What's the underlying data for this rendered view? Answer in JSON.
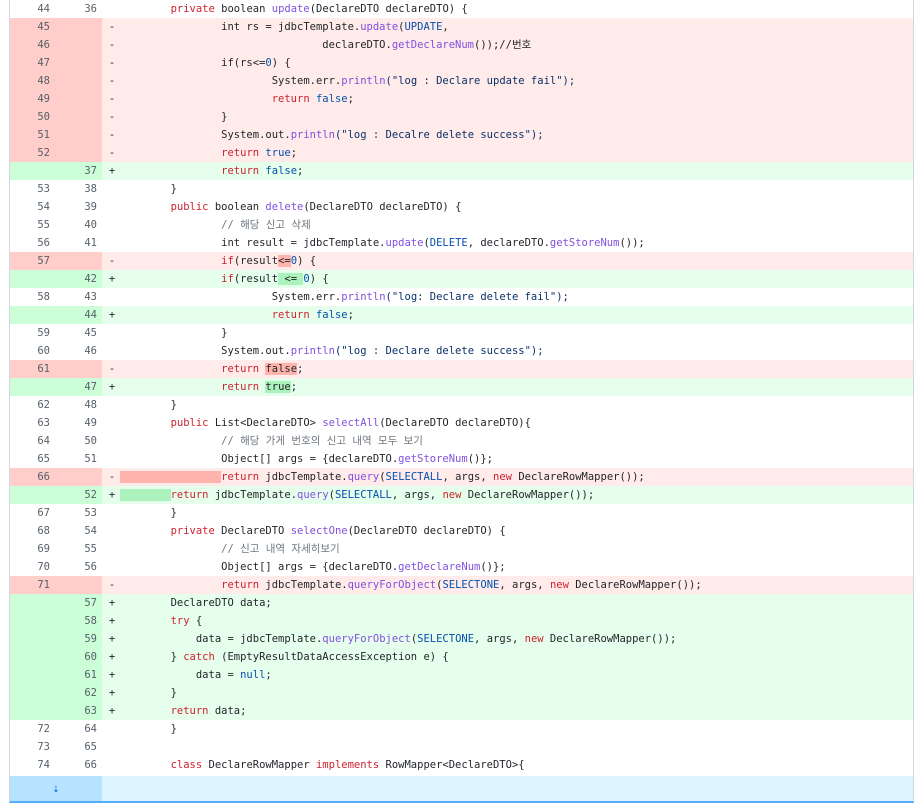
{
  "colors": {
    "deleted_bg": "#ffebe9",
    "deleted_gutter": "#ffcecb",
    "added_bg": "#e6ffec",
    "added_gutter": "#ccffd8",
    "expander_bg": "#ddf4ff",
    "border_accent": "#54aeff"
  },
  "lines": [
    {
      "type": "ctx",
      "old": "44",
      "new": "36",
      "mark": "",
      "indent": "",
      "code": [
        {
          "t": "        "
        },
        {
          "t": "private",
          "c": "kw"
        },
        {
          "t": " boolean "
        },
        {
          "t": "update",
          "c": "fn"
        },
        {
          "t": "(DeclareDTO declareDTO) {"
        }
      ]
    },
    {
      "type": "del",
      "old": "45",
      "new": "",
      "mark": "-",
      "code": [
        {
          "t": "                int rs = jdbcTemplate."
        },
        {
          "t": "update",
          "c": "fn"
        },
        {
          "t": "("
        },
        {
          "t": "UPDATE",
          "c": "cn"
        },
        {
          "t": ","
        }
      ]
    },
    {
      "type": "del",
      "old": "46",
      "new": "",
      "mark": "-",
      "code": [
        {
          "t": "                                declareDTO."
        },
        {
          "t": "getDeclareNum",
          "c": "fn"
        },
        {
          "t": "());//번호"
        }
      ]
    },
    {
      "type": "del",
      "old": "47",
      "new": "",
      "mark": "-",
      "code": [
        {
          "t": "                if(rs<="
        },
        {
          "t": "0",
          "c": "cn"
        },
        {
          "t": ") {"
        }
      ]
    },
    {
      "type": "del",
      "old": "48",
      "new": "",
      "mark": "-",
      "code": [
        {
          "t": "                        System.err."
        },
        {
          "t": "println",
          "c": "fn"
        },
        {
          "t": "(\"log : Declare update fail\");",
          "c": "str"
        }
      ]
    },
    {
      "type": "del",
      "old": "49",
      "new": "",
      "mark": "-",
      "code": [
        {
          "t": "                        "
        },
        {
          "t": "return",
          "c": "kw"
        },
        {
          "t": " "
        },
        {
          "t": "false",
          "c": "cn"
        },
        {
          "t": ";"
        }
      ]
    },
    {
      "type": "del",
      "old": "50",
      "new": "",
      "mark": "-",
      "code": [
        {
          "t": "                }"
        }
      ]
    },
    {
      "type": "del",
      "old": "51",
      "new": "",
      "mark": "-",
      "code": [
        {
          "t": "                System.out."
        },
        {
          "t": "println",
          "c": "fn"
        },
        {
          "t": "(\"log : Decalre delete success\");",
          "c": "str"
        }
      ]
    },
    {
      "type": "del",
      "old": "52",
      "new": "",
      "mark": "-",
      "code": [
        {
          "t": "                "
        },
        {
          "t": "return",
          "c": "kw"
        },
        {
          "t": " "
        },
        {
          "t": "true",
          "c": "cn"
        },
        {
          "t": ";"
        }
      ]
    },
    {
      "type": "add",
      "old": "",
      "new": "37",
      "mark": "+",
      "code": [
        {
          "t": "                "
        },
        {
          "t": "return",
          "c": "kw"
        },
        {
          "t": " "
        },
        {
          "t": "false",
          "c": "cn"
        },
        {
          "t": ";"
        }
      ]
    },
    {
      "type": "ctx",
      "old": "53",
      "new": "38",
      "mark": "",
      "code": [
        {
          "t": "        }"
        }
      ]
    },
    {
      "type": "ctx",
      "old": "54",
      "new": "39",
      "mark": "",
      "code": [
        {
          "t": "        "
        },
        {
          "t": "public",
          "c": "kw"
        },
        {
          "t": " boolean "
        },
        {
          "t": "delete",
          "c": "fn"
        },
        {
          "t": "(DeclareDTO declareDTO) {"
        }
      ]
    },
    {
      "type": "ctx",
      "old": "55",
      "new": "40",
      "mark": "",
      "code": [
        {
          "t": "                "
        },
        {
          "t": "// 해당 신고 삭제",
          "c": "cmt"
        }
      ]
    },
    {
      "type": "ctx",
      "old": "56",
      "new": "41",
      "mark": "",
      "code": [
        {
          "t": "                int result = jdbcTemplate."
        },
        {
          "t": "update",
          "c": "fn"
        },
        {
          "t": "("
        },
        {
          "t": "DELETE",
          "c": "cn"
        },
        {
          "t": ", declareDTO."
        },
        {
          "t": "getStoreNum",
          "c": "fn"
        },
        {
          "t": "());"
        }
      ]
    },
    {
      "type": "del",
      "old": "57",
      "new": "",
      "mark": "-",
      "code": [
        {
          "t": "                "
        },
        {
          "t": "if",
          "c": "kw"
        },
        {
          "t": "(result"
        },
        {
          "t": "<=",
          "c": "hl-del"
        },
        {
          "t": "0",
          "c": "cn"
        },
        {
          "t": ") {"
        }
      ]
    },
    {
      "type": "add",
      "old": "",
      "new": "42",
      "mark": "+",
      "code": [
        {
          "t": "                "
        },
        {
          "t": "if",
          "c": "kw"
        },
        {
          "t": "(result"
        },
        {
          "t": " <= ",
          "c": "hl-add"
        },
        {
          "t": "0",
          "c": "cn"
        },
        {
          "t": ") {"
        }
      ]
    },
    {
      "type": "ctx",
      "old": "58",
      "new": "43",
      "mark": "",
      "code": [
        {
          "t": "                        System.err."
        },
        {
          "t": "println",
          "c": "fn"
        },
        {
          "t": "(\"log: Declare delete fail\");",
          "c": "str"
        }
      ]
    },
    {
      "type": "add",
      "old": "",
      "new": "44",
      "mark": "+",
      "code": [
        {
          "t": "                        "
        },
        {
          "t": "return",
          "c": "kw"
        },
        {
          "t": " "
        },
        {
          "t": "false",
          "c": "cn"
        },
        {
          "t": ";"
        }
      ]
    },
    {
      "type": "ctx",
      "old": "59",
      "new": "45",
      "mark": "",
      "code": [
        {
          "t": "                }"
        }
      ]
    },
    {
      "type": "ctx",
      "old": "60",
      "new": "46",
      "mark": "",
      "code": [
        {
          "t": "                System.out."
        },
        {
          "t": "println",
          "c": "fn"
        },
        {
          "t": "(\"log : Declare delete success\");",
          "c": "str"
        }
      ]
    },
    {
      "type": "del",
      "old": "61",
      "new": "",
      "mark": "-",
      "code": [
        {
          "t": "                "
        },
        {
          "t": "return",
          "c": "kw"
        },
        {
          "t": " "
        },
        {
          "t": "false",
          "c": "hl-del"
        },
        {
          "t": ";"
        }
      ]
    },
    {
      "type": "add",
      "old": "",
      "new": "47",
      "mark": "+",
      "code": [
        {
          "t": "                "
        },
        {
          "t": "return",
          "c": "kw"
        },
        {
          "t": " "
        },
        {
          "t": "true",
          "c": "hl-add"
        },
        {
          "t": ";"
        }
      ]
    },
    {
      "type": "ctx",
      "old": "62",
      "new": "48",
      "mark": "",
      "code": [
        {
          "t": "        }"
        }
      ]
    },
    {
      "type": "ctx",
      "old": "63",
      "new": "49",
      "mark": "",
      "code": [
        {
          "t": "        "
        },
        {
          "t": "public",
          "c": "kw"
        },
        {
          "t": " List<DeclareDTO> "
        },
        {
          "t": "selectAll",
          "c": "fn"
        },
        {
          "t": "(DeclareDTO declareDTO){"
        }
      ]
    },
    {
      "type": "ctx",
      "old": "64",
      "new": "50",
      "mark": "",
      "code": [
        {
          "t": "                "
        },
        {
          "t": "// 해당 가게 번호의 신고 내역 모두 보기",
          "c": "cmt"
        }
      ]
    },
    {
      "type": "ctx",
      "old": "65",
      "new": "51",
      "mark": "",
      "code": [
        {
          "t": "                Object[] args = {declareDTO."
        },
        {
          "t": "getStoreNum",
          "c": "fn"
        },
        {
          "t": "()};"
        }
      ]
    },
    {
      "type": "del",
      "old": "66",
      "new": "",
      "mark": "-",
      "code": [
        {
          "t": "                ",
          "c": "hl-del"
        },
        {
          "t": "return",
          "c": "kw"
        },
        {
          "t": " jdbcTemplate."
        },
        {
          "t": "query",
          "c": "fn"
        },
        {
          "t": "("
        },
        {
          "t": "SELECTALL",
          "c": "cn"
        },
        {
          "t": ", args, "
        },
        {
          "t": "new",
          "c": "kw"
        },
        {
          "t": " DeclareRowMapper());"
        }
      ]
    },
    {
      "type": "add",
      "old": "",
      "new": "52",
      "mark": "+",
      "code": [
        {
          "t": "        ",
          "c": "hl-add"
        },
        {
          "t": "return",
          "c": "kw"
        },
        {
          "t": " jdbcTemplate."
        },
        {
          "t": "query",
          "c": "fn"
        },
        {
          "t": "("
        },
        {
          "t": "SELECTALL",
          "c": "cn"
        },
        {
          "t": ", args, "
        },
        {
          "t": "new",
          "c": "kw"
        },
        {
          "t": " DeclareRowMapper());"
        }
      ]
    },
    {
      "type": "ctx",
      "old": "67",
      "new": "53",
      "mark": "",
      "code": [
        {
          "t": "        }"
        }
      ]
    },
    {
      "type": "ctx",
      "old": "68",
      "new": "54",
      "mark": "",
      "code": [
        {
          "t": "        "
        },
        {
          "t": "private",
          "c": "kw"
        },
        {
          "t": " DeclareDTO "
        },
        {
          "t": "selectOne",
          "c": "fn"
        },
        {
          "t": "(DeclareDTO declareDTO) {"
        }
      ]
    },
    {
      "type": "ctx",
      "old": "69",
      "new": "55",
      "mark": "",
      "code": [
        {
          "t": "                "
        },
        {
          "t": "// 신고 내역 자세히보기",
          "c": "cmt"
        }
      ]
    },
    {
      "type": "ctx",
      "old": "70",
      "new": "56",
      "mark": "",
      "code": [
        {
          "t": "                Object[] args = {declareDTO."
        },
        {
          "t": "getDeclareNum",
          "c": "fn"
        },
        {
          "t": "()};"
        }
      ]
    },
    {
      "type": "del",
      "old": "71",
      "new": "",
      "mark": "-",
      "code": [
        {
          "t": "                "
        },
        {
          "t": "return",
          "c": "kw"
        },
        {
          "t": " jdbcTemplate."
        },
        {
          "t": "queryForObject",
          "c": "fn"
        },
        {
          "t": "("
        },
        {
          "t": "SELECTONE",
          "c": "cn"
        },
        {
          "t": ", args, "
        },
        {
          "t": "new",
          "c": "kw"
        },
        {
          "t": " DeclareRowMapper());"
        }
      ]
    },
    {
      "type": "add",
      "old": "",
      "new": "57",
      "mark": "+",
      "code": [
        {
          "t": "        DeclareDTO data;"
        }
      ]
    },
    {
      "type": "add",
      "old": "",
      "new": "58",
      "mark": "+",
      "code": [
        {
          "t": "        "
        },
        {
          "t": "try",
          "c": "kw"
        },
        {
          "t": " {"
        }
      ]
    },
    {
      "type": "add",
      "old": "",
      "new": "59",
      "mark": "+",
      "code": [
        {
          "t": "            data = jdbcTemplate."
        },
        {
          "t": "queryForObject",
          "c": "fn"
        },
        {
          "t": "("
        },
        {
          "t": "SELECTONE",
          "c": "cn"
        },
        {
          "t": ", args, "
        },
        {
          "t": "new",
          "c": "kw"
        },
        {
          "t": " DeclareRowMapper());"
        }
      ]
    },
    {
      "type": "add",
      "old": "",
      "new": "60",
      "mark": "+",
      "code": [
        {
          "t": "        } "
        },
        {
          "t": "catch",
          "c": "kw"
        },
        {
          "t": " (EmptyResultDataAccessException e) {"
        }
      ]
    },
    {
      "type": "add",
      "old": "",
      "new": "61",
      "mark": "+",
      "code": [
        {
          "t": "            data = "
        },
        {
          "t": "null",
          "c": "cn"
        },
        {
          "t": ";"
        }
      ]
    },
    {
      "type": "add",
      "old": "",
      "new": "62",
      "mark": "+",
      "code": [
        {
          "t": "        }"
        }
      ]
    },
    {
      "type": "add",
      "old": "",
      "new": "63",
      "mark": "+",
      "code": [
        {
          "t": "        "
        },
        {
          "t": "return",
          "c": "kw"
        },
        {
          "t": " data;"
        }
      ]
    },
    {
      "type": "ctx",
      "old": "72",
      "new": "64",
      "mark": "",
      "code": [
        {
          "t": "        }"
        }
      ]
    },
    {
      "type": "ctx",
      "old": "73",
      "new": "65",
      "mark": "",
      "code": [
        {
          "t": ""
        }
      ]
    },
    {
      "type": "ctx",
      "old": "74",
      "new": "66",
      "mark": "",
      "code": [
        {
          "t": "        "
        },
        {
          "t": "class",
          "c": "kw"
        },
        {
          "t": " DeclareRowMapper "
        },
        {
          "t": "implements",
          "c": "kw"
        },
        {
          "t": " RowMapper<DeclareDTO>{"
        }
      ]
    }
  ],
  "expander": {
    "icon": "expand-down-icon",
    "glyph": "⇣"
  }
}
